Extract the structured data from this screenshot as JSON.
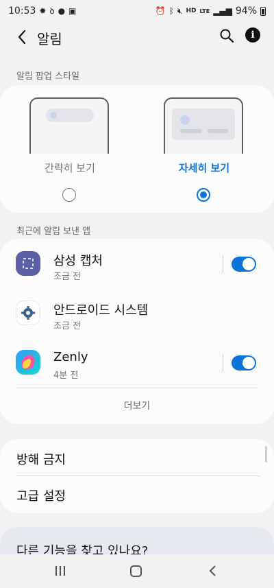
{
  "status_bar": {
    "time": "10:53",
    "network_badge_top": "HD",
    "network_badge_lte": "LTE",
    "battery_percent": "94%"
  },
  "app_bar": {
    "title": "알림",
    "back_icon": "back-arrow-icon",
    "search_icon": "search-icon",
    "info_icon": "info-icon",
    "info_glyph": "i"
  },
  "popup_style": {
    "section_label": "알림 팝업 스타일",
    "options": [
      {
        "label": "간략히 보기",
        "selected": false
      },
      {
        "label": "자세히 보기",
        "selected": true
      }
    ],
    "accent_color": "#0a74da"
  },
  "recent_apps": {
    "section_label": "최근에 알림 보낸 앱",
    "apps": [
      {
        "name": "삼성 캡처",
        "time": "조금 전",
        "toggle": true,
        "icon": "samsung-capture-icon"
      },
      {
        "name": "안드로이드 시스템",
        "time": "조금 전",
        "toggle": null,
        "icon": "android-system-gear-icon"
      },
      {
        "name": "Zenly",
        "time": "4분 전",
        "toggle": true,
        "icon": "zenly-icon"
      }
    ],
    "more_label": "더보기"
  },
  "settings": {
    "items": [
      "방해 금지",
      "고급 설정"
    ]
  },
  "other_features": {
    "title": "다른 기능을 찾고 있나요?"
  },
  "nav_bar": {
    "recents_icon": "recents-icon",
    "home_icon": "home-icon",
    "back_icon": "nav-back-icon"
  }
}
